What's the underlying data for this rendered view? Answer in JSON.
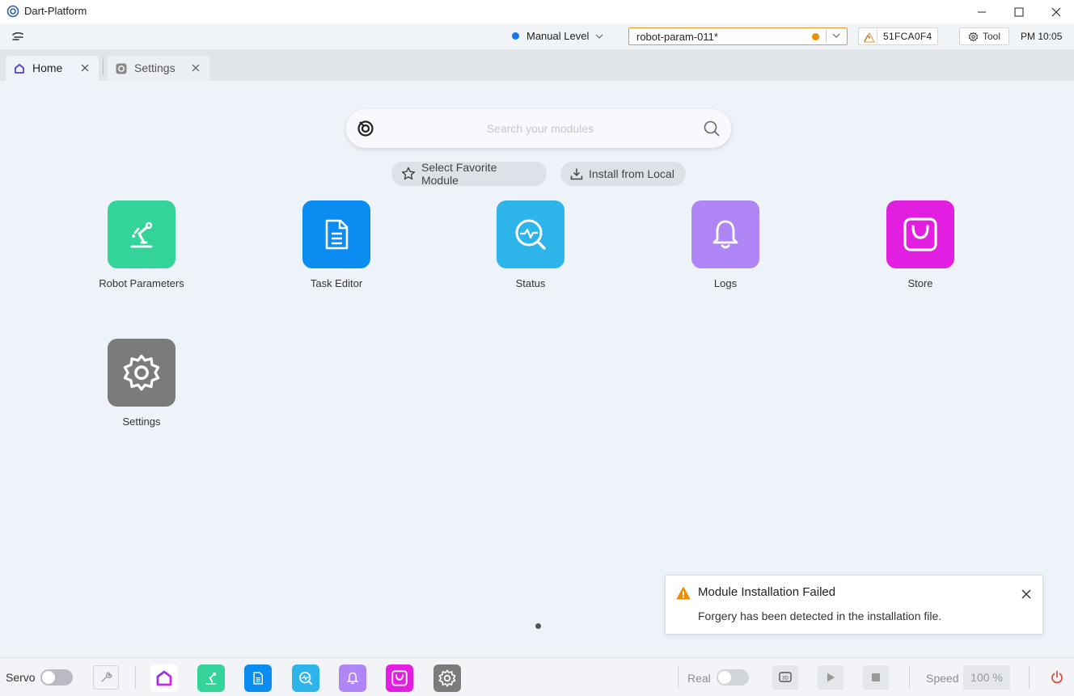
{
  "window": {
    "title": "Dart-Platform"
  },
  "header": {
    "level_label": "Manual Level",
    "level_color": "#1677f2",
    "param_value": "robot-param-011*",
    "param_status_color": "#f08c00",
    "device_id": "51FCA0F4",
    "tool_label": "Tool",
    "clock": "PM 10:05"
  },
  "tabs": [
    {
      "label": "Home",
      "icon": "home-icon",
      "active": true
    },
    {
      "label": "Settings",
      "icon": "settings-icon",
      "active": false
    }
  ],
  "search": {
    "placeholder": "Search your modules",
    "value": ""
  },
  "actions": {
    "favorite_label": "Select Favorite Module",
    "install_label": "Install from Local"
  },
  "modules": [
    {
      "label": "Robot Parameters",
      "icon": "robot-arm-icon",
      "color": "#34d399"
    },
    {
      "label": "Task Editor",
      "icon": "document-icon",
      "color": "#0a8cf0"
    },
    {
      "label": "Status",
      "icon": "pulse-magnifier-icon",
      "color": "#2db4e8"
    },
    {
      "label": "Logs",
      "icon": "bell-icon",
      "color": "#b085f5"
    },
    {
      "label": "Store",
      "icon": "shopping-bag-icon",
      "color": "#e21ee0"
    },
    {
      "label": "Settings",
      "icon": "gear-icon",
      "color": "#7b7b7b"
    }
  ],
  "toast": {
    "title": "Module Installation Failed",
    "message": "Forgery has been detected in the installation file.",
    "icon": "warning-icon",
    "color": "#f08c00"
  },
  "bottom": {
    "servo_label": "Servo",
    "servo_on": false,
    "real_label": "Real",
    "real_on": false,
    "speed_label": "Speed",
    "speed_value": "100 %",
    "power_color": "#e0453a"
  }
}
